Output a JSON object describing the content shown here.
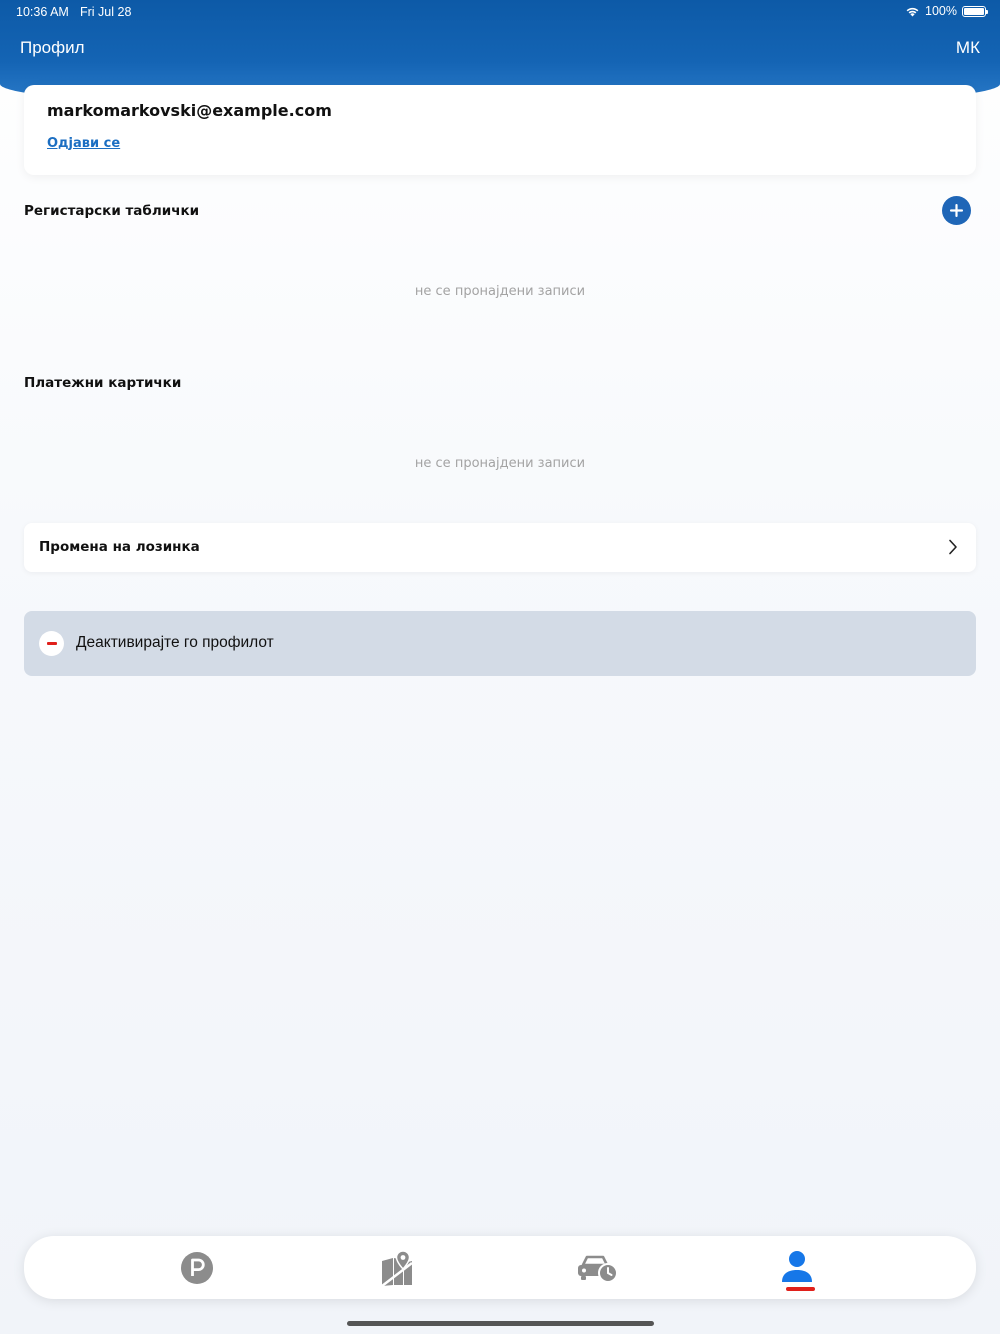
{
  "status_bar": {
    "time": "10:36 AM",
    "date": "Fri Jul 28",
    "battery": "100%"
  },
  "header": {
    "title": "Профил",
    "language": "МК"
  },
  "account": {
    "email": "markomarkovski@example.com",
    "logout_label": "Одјави се"
  },
  "plates": {
    "title": "Регистарски таблички",
    "empty_text": "не се пронајдени записи",
    "add_icon": "plus-icon"
  },
  "cards": {
    "title": "Платежни картички",
    "empty_text": "не се пронајдени записи"
  },
  "change_password": {
    "label": "Промена на лозинка"
  },
  "deactivate": {
    "label": "Деактивирајте го профилот"
  },
  "tabs": [
    {
      "icon": "parking-icon",
      "active": false
    },
    {
      "icon": "map-pin-icon",
      "active": false
    },
    {
      "icon": "car-clock-icon",
      "active": false
    },
    {
      "icon": "profile-icon",
      "active": true
    }
  ],
  "colors": {
    "header_blue": "#1464b4",
    "accent_blue": "#1f66b7",
    "link_blue": "#1b6ec2",
    "danger_red": "#e0201b",
    "active_tab": "#1677e8",
    "inactive_tab": "#8c8c8c"
  }
}
